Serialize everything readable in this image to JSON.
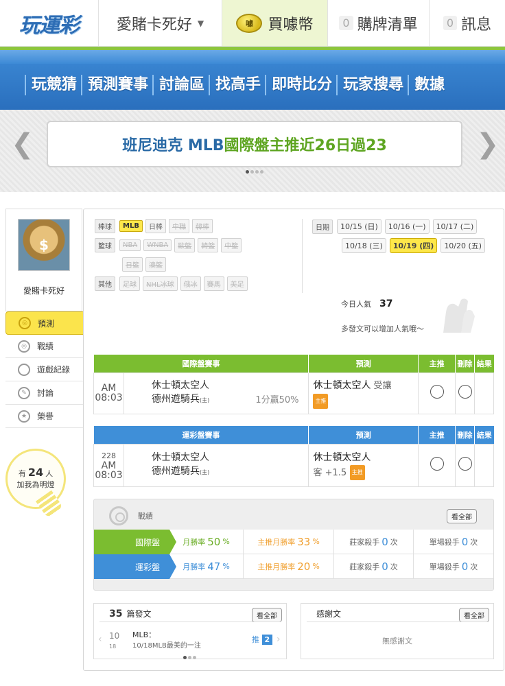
{
  "header": {
    "logo": "玩運彩",
    "username": "愛賭卡死好",
    "buy_label": "買噱幣",
    "coin_glyph": "噱",
    "cart": {
      "count": "0",
      "label": "購牌清單"
    },
    "messages": {
      "count": "0",
      "label": "訊息"
    }
  },
  "nav": {
    "items": [
      "玩競猜",
      "預測賽事",
      "討論區",
      "找高手",
      "即時比分",
      "玩家搜尋",
      "數據"
    ]
  },
  "banner": {
    "prefix": "班尼迪克 MLB ",
    "highlight": "國際盤主推近26日過23"
  },
  "sidebar": {
    "name": "愛賭卡死好",
    "menu": [
      "預測",
      "戰績",
      "遊戲紀錄",
      "討論",
      "榮譽"
    ],
    "fans_prefix": "有",
    "fans_count": "24",
    "fans_unit": "人",
    "fans_suffix": "加我為明燈"
  },
  "filters": {
    "baseball": {
      "label": "棒球",
      "tags": [
        "MLB",
        "日棒",
        "中職",
        "韓棒"
      ]
    },
    "basketball": {
      "label": "籃球",
      "tags": [
        "NBA",
        "WNBA",
        "歐籃",
        "韓籃",
        "中籃"
      ],
      "tags2": [
        "日籃",
        "澳籃"
      ]
    },
    "other": {
      "label": "其他",
      "tags": [
        "足球",
        "NHL冰球",
        "俄冰",
        "賽馬",
        "美足"
      ]
    }
  },
  "dates": {
    "label": "日期",
    "row1": [
      "10/15 (日)",
      "10/16 (一)",
      "10/17 (二)"
    ],
    "row2": [
      "10/18 (三)",
      "10/19 (四)",
      "10/20 (五)"
    ]
  },
  "popularity": {
    "label": "今日人氣",
    "value": "37",
    "hint": "多發文可以增加人氣哦～"
  },
  "intl_table": {
    "headers": [
      "國際盤賽事",
      "預測",
      "主推",
      "刪除",
      "結果"
    ],
    "ampm": "AM",
    "time": "08:03",
    "away": "休士頓太空人",
    "home": "德州遊騎兵",
    "host_mark": "(主)",
    "line": "1分贏50%",
    "pick": "休士頓太空人",
    "pick_sub": "受讓",
    "badge": "主推"
  },
  "sport_table": {
    "headers": [
      "運彩盤賽事",
      "預測",
      "主推",
      "刪除",
      "結果"
    ],
    "number": "228",
    "ampm": "AM",
    "time": "08:03",
    "away": "休士頓太空人",
    "home": "德州遊騎兵",
    "host_mark": "(主)",
    "pick": "休士頓太空人",
    "pick_sub": "客 +1.5",
    "badge": "主推"
  },
  "stats": {
    "title": "戰績",
    "view_all": "看全部",
    "rows": [
      {
        "label": "國際盤",
        "month_label": "月勝率",
        "month": "50",
        "main_label": "主推月勝率",
        "main": "33",
        "pct": "%",
        "bank_label": "莊家殺手",
        "bank": "0",
        "single_label": "單場殺手",
        "single": "0",
        "unit": "次"
      },
      {
        "label": "運彩盤",
        "month_label": "月勝率",
        "month": "47",
        "main_label": "主推月勝率",
        "main": "20",
        "pct": "%",
        "bank_label": "莊家殺手",
        "bank": "0",
        "single_label": "單場殺手",
        "single": "0",
        "unit": "次"
      }
    ]
  },
  "posts": {
    "count": "35",
    "label": "篇發文",
    "view_all": "看全部",
    "day": "10",
    "day_sub": "18",
    "title": "MLB：",
    "subtitle": "10/18MLB最美的一注",
    "push_label": "推",
    "push_count": "2"
  },
  "thanks": {
    "title": "感謝文",
    "view_all": "看全部",
    "empty": "無感謝文"
  }
}
